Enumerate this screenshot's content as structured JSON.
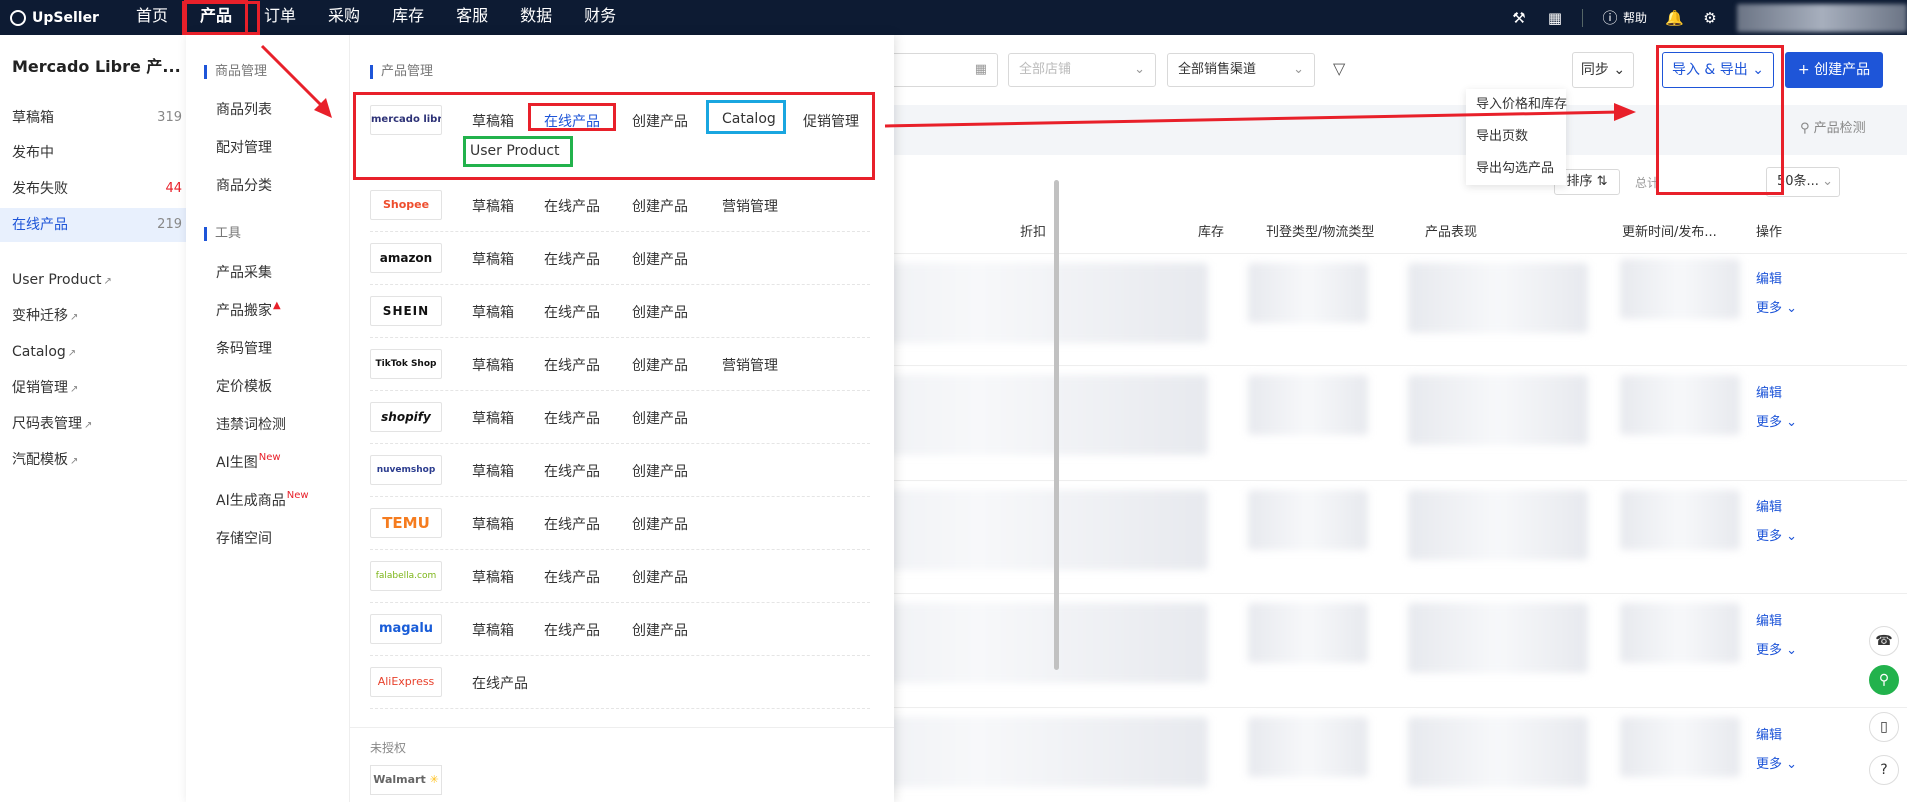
{
  "topnav": {
    "logo": "UpSeller",
    "items": [
      "首页",
      "产品",
      "订单",
      "采购",
      "库存",
      "客服",
      "数据",
      "财务"
    ],
    "help": "帮助"
  },
  "sidebar": {
    "title": "Mercado Libre 产...",
    "items": [
      {
        "label": "草稿箱",
        "count": "319"
      },
      {
        "label": "发布中",
        "count": ""
      },
      {
        "label": "发布失败",
        "count": "44"
      },
      {
        "label": "在线产品",
        "count": "219"
      }
    ],
    "links": [
      "User Product",
      "变种迁移",
      "Catalog",
      "促销管理",
      "尺码表管理",
      "汽配模板"
    ]
  },
  "filters": {
    "store": "全部店铺",
    "channel": "全部销售渠道"
  },
  "toolbar": {
    "sync": "同步",
    "import_export": "导入 & 导出",
    "create": "+ 创建产品",
    "check": "产品检测",
    "sort": "排序",
    "total": "总计",
    "page_size": "50条..."
  },
  "export_menu": [
    "导入价格和库存",
    "导出页数",
    "导出勾选产品"
  ],
  "table": {
    "headers": [
      "折扣",
      "库存",
      "刊登类型/物流类型",
      "产品表现",
      "更新时间/发布...",
      "操作"
    ],
    "edit": "编辑",
    "more": "更多"
  },
  "mega_menu": {
    "section1": "商品管理",
    "section1_items": [
      "商品列表",
      "配对管理",
      "商品分类"
    ],
    "section2": "工具",
    "section2_items": [
      "产品采集",
      "产品搬家",
      "条码管理",
      "定价模板",
      "违禁词检测",
      "AI生图",
      "AI生成商品",
      "存储空间"
    ],
    "new_badge": "New",
    "right_title": "产品管理",
    "platforms": [
      {
        "logo": "mercado libre",
        "links": [
          "草稿箱",
          "在线产品",
          "创建产品",
          "Catalog",
          "促销管理",
          "User Product"
        ]
      },
      {
        "logo": "Shopee",
        "links": [
          "草稿箱",
          "在线产品",
          "创建产品",
          "营销管理"
        ]
      },
      {
        "logo": "amazon",
        "links": [
          "草稿箱",
          "在线产品",
          "创建产品"
        ]
      },
      {
        "logo": "SHEIN",
        "links": [
          "草稿箱",
          "在线产品",
          "创建产品"
        ]
      },
      {
        "logo": "TikTok Shop",
        "links": [
          "草稿箱",
          "在线产品",
          "创建产品",
          "营销管理"
        ]
      },
      {
        "logo": "shopify",
        "links": [
          "草稿箱",
          "在线产品",
          "创建产品"
        ]
      },
      {
        "logo": "nuvemshop",
        "links": [
          "草稿箱",
          "在线产品",
          "创建产品"
        ]
      },
      {
        "logo": "TEMU",
        "links": [
          "草稿箱",
          "在线产品",
          "创建产品"
        ]
      },
      {
        "logo": "falabella.com",
        "links": [
          "草稿箱",
          "在线产品",
          "创建产品"
        ]
      },
      {
        "logo": "magalu",
        "links": [
          "草稿箱",
          "在线产品",
          "创建产品"
        ]
      },
      {
        "logo": "AliExpress",
        "links": [
          "在线产品"
        ]
      }
    ],
    "unauthorized": "未授权",
    "walmart": "Walmart"
  }
}
